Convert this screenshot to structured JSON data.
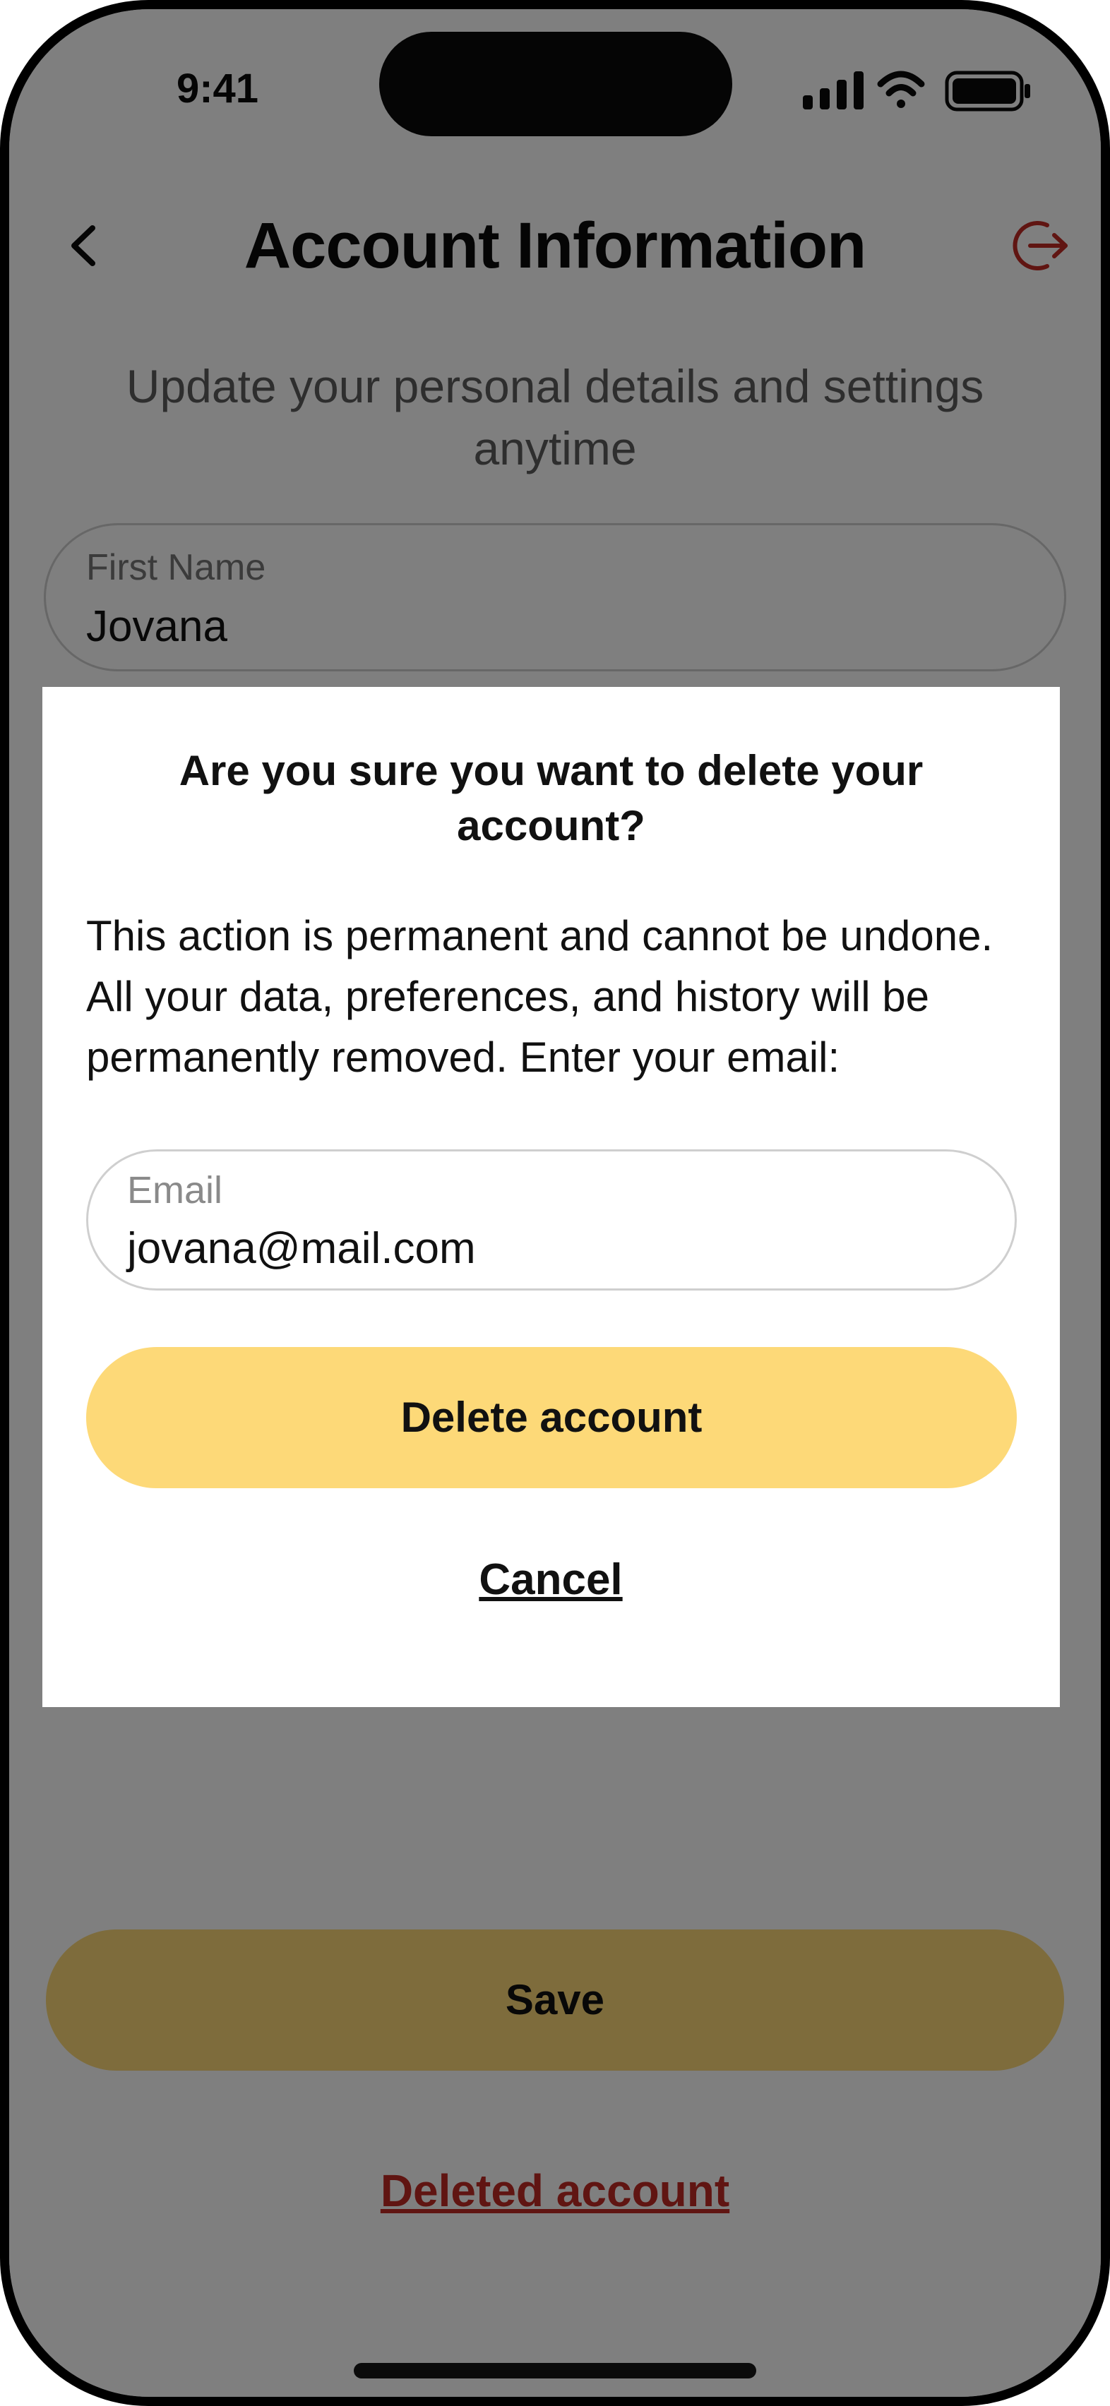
{
  "status_bar": {
    "time": "9:41"
  },
  "header": {
    "title": "Account Information"
  },
  "subtitle": "Update your personal details and settings anytime",
  "form": {
    "first_name": {
      "label": "First Name",
      "value": "Jovana"
    }
  },
  "actions": {
    "save_label": "Save",
    "deleted_account_label": "Deleted account"
  },
  "modal": {
    "title": "Are you sure you want to delete your account?",
    "body": "This action is permanent and cannot be undone. All your data, preferences, and history will be permanently removed. Enter your email:",
    "email": {
      "label": "Email",
      "value": "jovana@mail.com"
    },
    "delete_label": "Delete account",
    "cancel_label": "Cancel"
  },
  "colors": {
    "accent_yellow": "#fdd978",
    "danger_red": "#c12a24",
    "overlay": "rgba(0,0,0,0.5)"
  },
  "icons": [
    "chevron-left-icon",
    "logout-icon",
    "signal-icon",
    "wifi-icon",
    "battery-icon"
  ]
}
